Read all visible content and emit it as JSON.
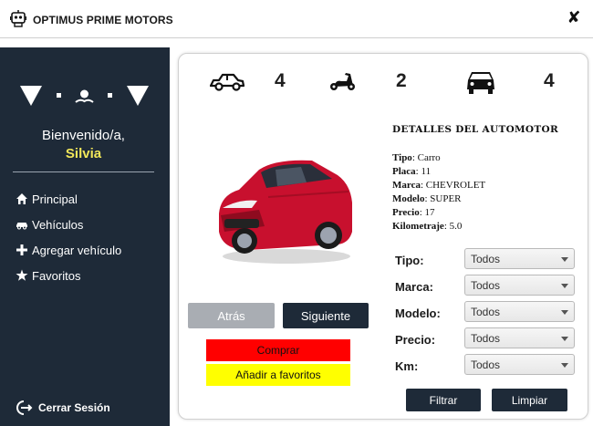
{
  "window": {
    "title": "OPTIMUS PRIME MOTORS",
    "close_glyph": "✘"
  },
  "sidebar": {
    "welcome": "Bienvenido/a,",
    "username": "Silvia",
    "items": [
      {
        "label": "Principal",
        "icon": "home-icon"
      },
      {
        "label": "Vehículos",
        "icon": "car-icon"
      },
      {
        "label": "Agregar vehículo",
        "icon": "plus-icon"
      },
      {
        "label": "Favoritos",
        "icon": "star-icon"
      }
    ],
    "logout": "Cerrar Sesión"
  },
  "stats": {
    "cars": "4",
    "motorcycles": "2",
    "trucks": "4"
  },
  "details": {
    "title": "DETALLES DEL AUTOMOTOR",
    "rows": [
      {
        "label": "Tipo",
        "value": "Carro"
      },
      {
        "label": "Placa",
        "value": "11"
      },
      {
        "label": "Marca",
        "value": "CHEVROLET"
      },
      {
        "label": "Modelo",
        "value": "SUPER"
      },
      {
        "label": "Precio",
        "value": "17"
      },
      {
        "label": "Kilometraje",
        "value": "5.0"
      }
    ]
  },
  "buttons": {
    "prev": "Atrás",
    "next": "Siguiente",
    "buy": "Comprar",
    "favorite": "Añadir a favoritos",
    "filter": "Filtrar",
    "clear": "Limpiar"
  },
  "filters": [
    {
      "label": "Tipo:",
      "value": "Todos"
    },
    {
      "label": "Marca:",
      "value": "Todos"
    },
    {
      "label": "Modelo:",
      "value": "Todos"
    },
    {
      "label": "Precio:",
      "value": "Todos"
    },
    {
      "label": "Km:",
      "value": "Todos"
    }
  ],
  "colors": {
    "sidebar": "#1e2a38",
    "username": "#f2e75a",
    "buy": "#ff0000",
    "favorite": "#ffff00",
    "disabled": "#a9adb3"
  }
}
